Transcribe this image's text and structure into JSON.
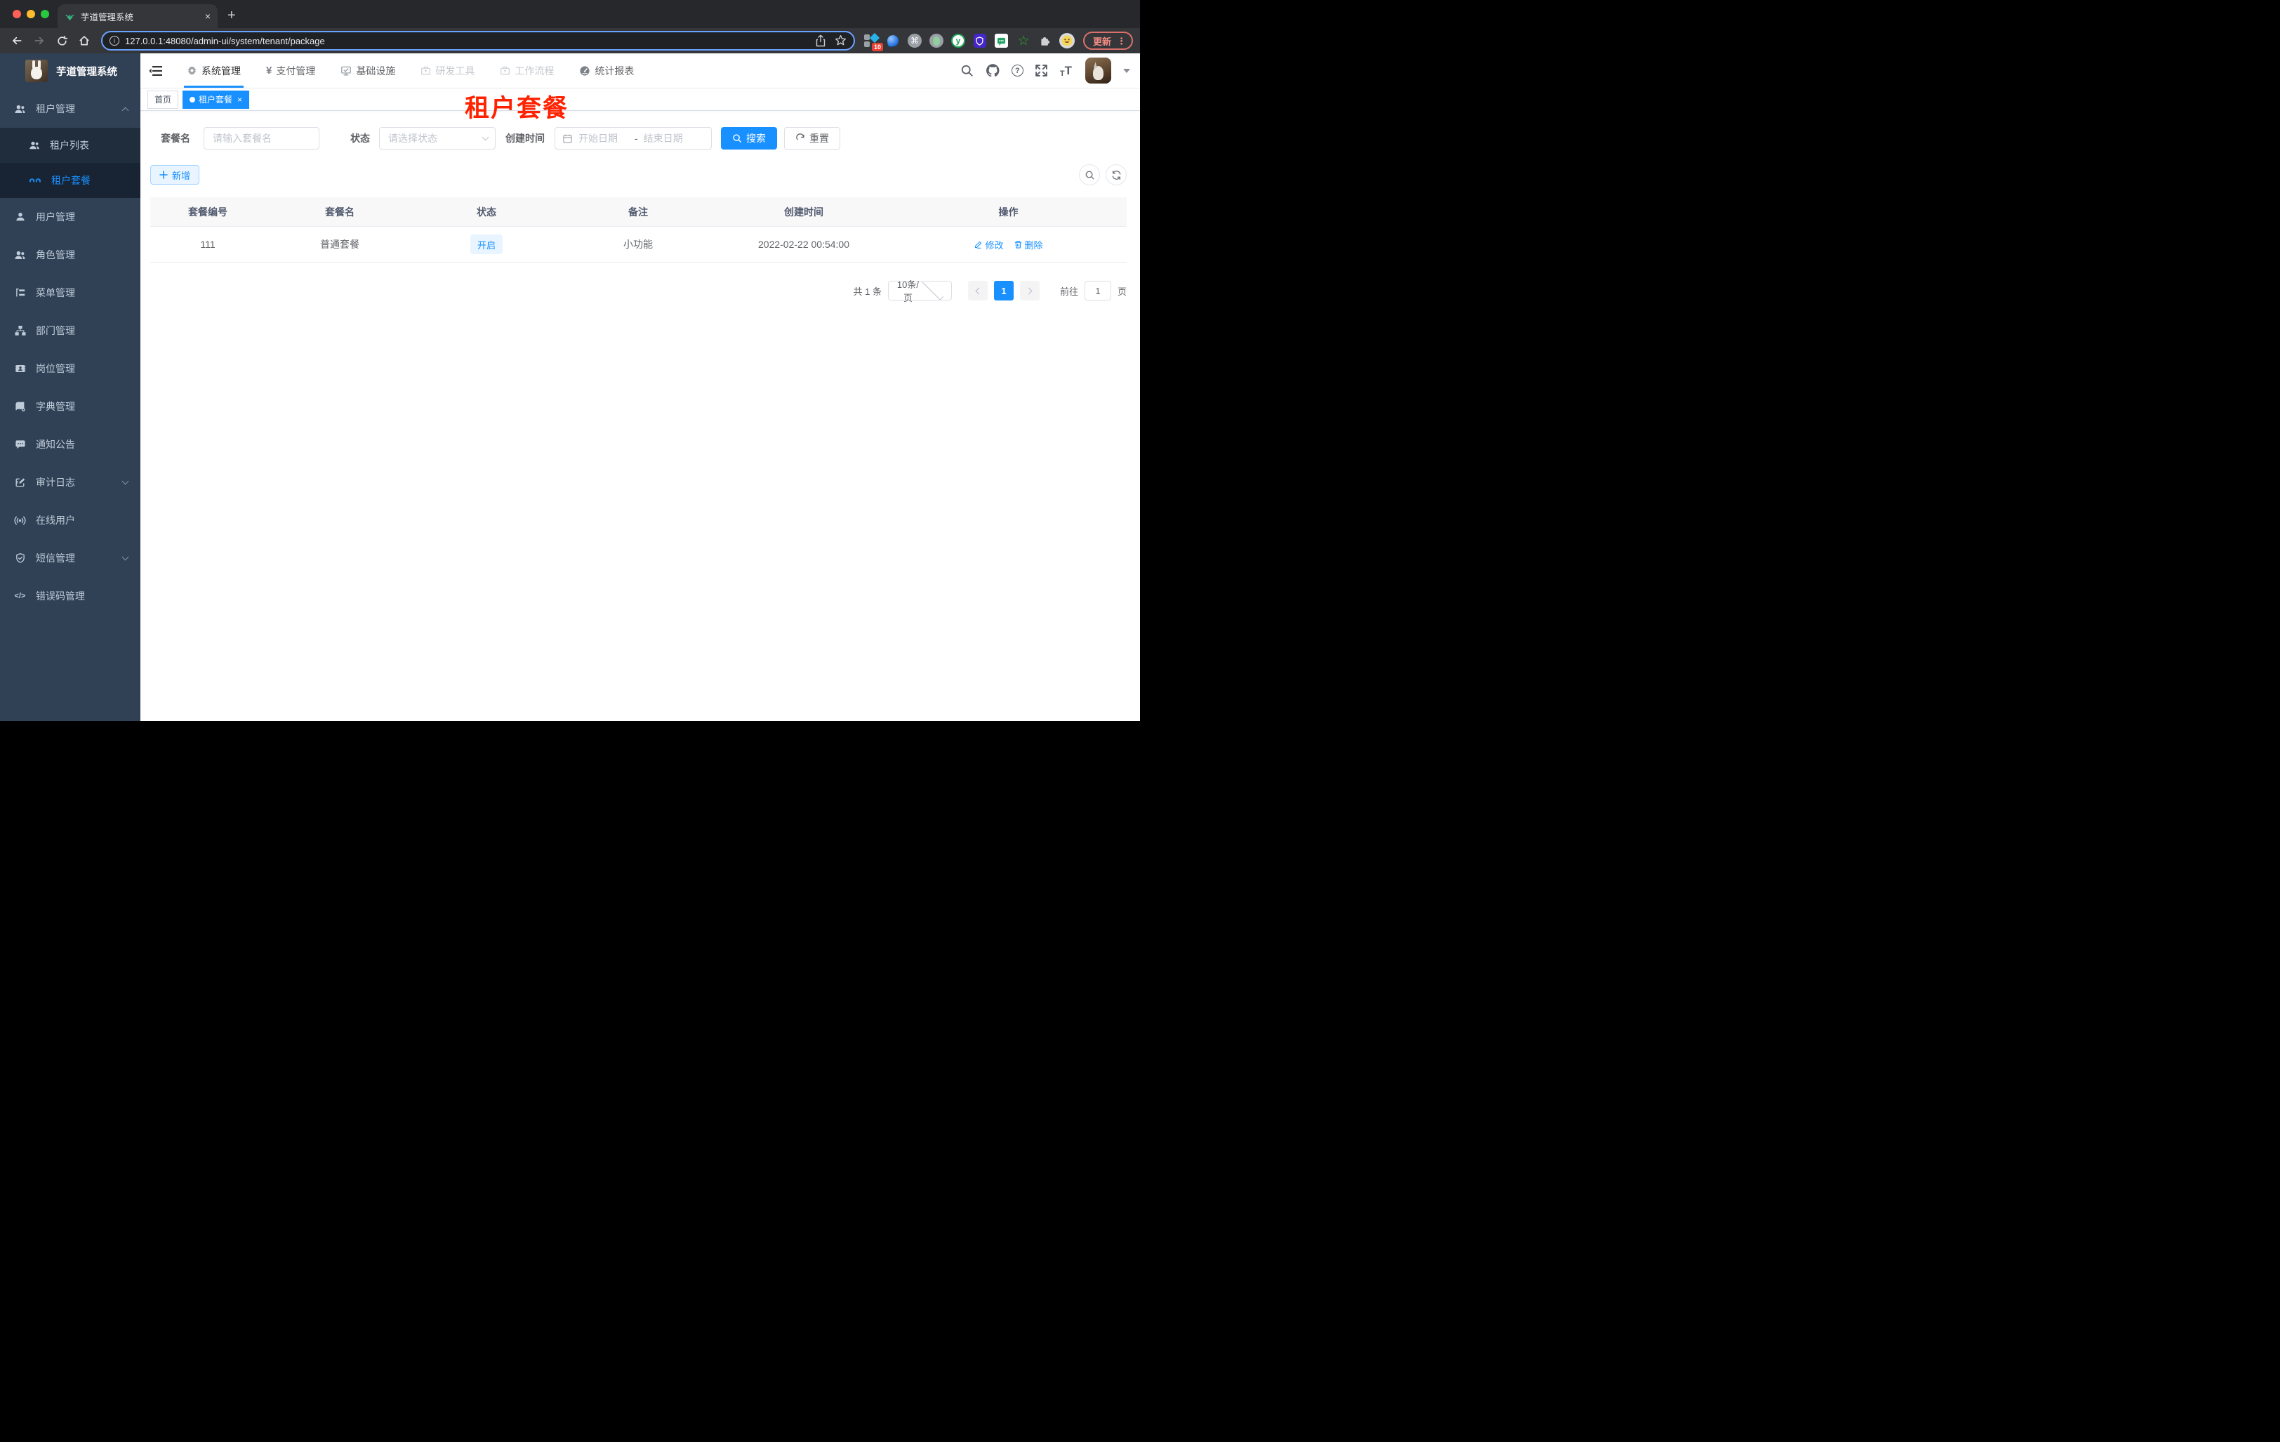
{
  "browser": {
    "tab_title": "芋道管理系统",
    "url": "127.0.0.1:48080/admin-ui/system/tenant/package",
    "update_label": "更新",
    "extension_badge": "10"
  },
  "icons": {
    "close": "×",
    "plus": "+",
    "info": "i",
    "command": "⌘",
    "letter_y": "y",
    "star_outline": "☆",
    "question": "?",
    "font_small": "T",
    "font_big": "T",
    "code": "</>",
    "ellipsis": "⋮",
    "tag_dot": "",
    "smile": "😀"
  },
  "sidebar": {
    "logo_title": "芋道管理系统",
    "items": [
      {
        "label": "租户管理",
        "expanded": true,
        "children": [
          {
            "label": "租户列表"
          },
          {
            "label": "租户套餐",
            "active": true
          }
        ]
      },
      {
        "label": "用户管理"
      },
      {
        "label": "角色管理"
      },
      {
        "label": "菜单管理"
      },
      {
        "label": "部门管理"
      },
      {
        "label": "岗位管理"
      },
      {
        "label": "字典管理"
      },
      {
        "label": "通知公告"
      },
      {
        "label": "审计日志",
        "collapsible": true
      },
      {
        "label": "在线用户"
      },
      {
        "label": "短信管理",
        "collapsible": true
      },
      {
        "label": "错误码管理"
      }
    ]
  },
  "navbar": {
    "menus": [
      {
        "label": "系统管理",
        "active": true
      },
      {
        "label": "支付管理"
      },
      {
        "label": "基础设施"
      },
      {
        "label": "研发工具",
        "muted": true
      },
      {
        "label": "工作流程",
        "muted": true
      },
      {
        "label": "统计报表"
      }
    ]
  },
  "tags": [
    {
      "label": "首页"
    },
    {
      "label": "租户套餐",
      "active": true
    }
  ],
  "annotation": {
    "text": "租户套餐"
  },
  "filters": {
    "package_name_label": "套餐名",
    "package_name_placeholder": "请输入套餐名",
    "status_label": "状态",
    "status_placeholder": "请选择状态",
    "create_time_label": "创建时间",
    "start_placeholder": "开始日期",
    "separator": "-",
    "end_placeholder": "结束日期",
    "search_label": "搜索",
    "reset_label": "重置"
  },
  "toolbar": {
    "add_label": "新增"
  },
  "table": {
    "headers": [
      "套餐编号",
      "套餐名",
      "状态",
      "备注",
      "创建时间",
      "操作"
    ],
    "rows": [
      {
        "id": "111",
        "name": "普通套餐",
        "status": "开启",
        "remark": "小功能",
        "create_time": "2022-02-22 00:54:00",
        "actions": [
          "修改",
          "删除"
        ]
      }
    ]
  },
  "pagination": {
    "total": "共 1 条",
    "page_size": "10条/页",
    "current": "1",
    "goto_label": "前往",
    "goto_value": "1",
    "page_label": "页"
  },
  "colors": {
    "primary": "#1890ff",
    "sidebar_bg": "#304156",
    "submenu_bg": "#1f2d3d",
    "annotation_red": "#ff2200",
    "header_row_bg": "#f8f8f9",
    "chrome_dark": "#35363a",
    "update_chip": "#f28b82"
  }
}
